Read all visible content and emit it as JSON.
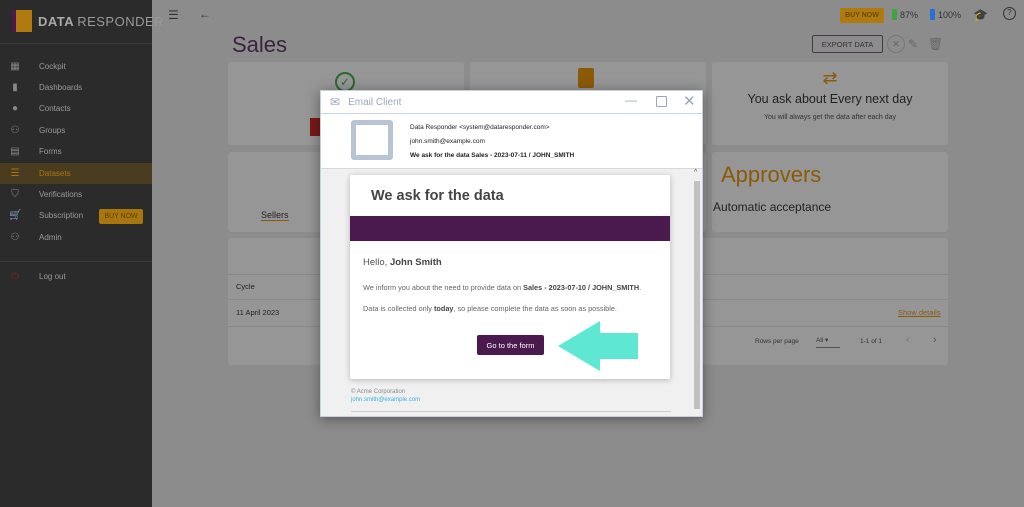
{
  "app": {
    "brand_bold": "DATA",
    "brand_light": "RESPONDER"
  },
  "sidebar": {
    "items": [
      {
        "label": "Cockpit",
        "icon": "▦"
      },
      {
        "label": "Dashboards",
        "icon": "▮"
      },
      {
        "label": "Contacts",
        "icon": "●"
      },
      {
        "label": "Groups",
        "icon": "⚇"
      },
      {
        "label": "Forms",
        "icon": "▤"
      },
      {
        "label": "Datasets",
        "icon": "☰"
      },
      {
        "label": "Verifications",
        "icon": "⛉"
      },
      {
        "label": "Subscription",
        "icon": "🛒"
      },
      {
        "label": "Admin",
        "icon": "⚇"
      }
    ],
    "buy_now": "BUY NOW",
    "logout": "Log out",
    "active": "Datasets"
  },
  "topbar": {
    "buy_now": "BUY NOW",
    "battery1": "87%",
    "battery2": "100%",
    "colors": {
      "battery1": "#3fa63f",
      "battery2": "#2a6fd6"
    }
  },
  "page": {
    "title": "Sales",
    "export": "EXPORT DATA"
  },
  "cards": {
    "frequency_title": "You ask about Every next day",
    "frequency_sub": "You will always get the data after each day",
    "sellers": "Sellers",
    "approvers_title": "Approvers",
    "approvers_sub": "Automatic acceptance"
  },
  "table": {
    "header": "Cycle",
    "rows": [
      {
        "cycle": "11 April 2023",
        "action": "Show details"
      }
    ],
    "rows_per_page_label": "Rows per page",
    "rows_per_page": "All",
    "range": "1-1 of 1"
  },
  "email": {
    "window_title": "Email Client",
    "from": "Data Responder <system@dataresponder.com>",
    "to": "john.smith@example.com",
    "subject": "We ask for the data Sales - 2023-07-11 / JOHN_SMITH",
    "heading": "We ask for the data",
    "hello": "Hello, ",
    "name": "John Smith",
    "p1": "We inform you about the need to provide data on ",
    "p1_bold": "Sales - 2023-07-10 / JOHN_SMITH",
    "p1_end": ".",
    "p2a": "Data is collected only ",
    "p2_bold": "today",
    "p2b": ", so please complete the data as soon as possible.",
    "button": "Go to the form",
    "footer_company": "© Acme Corporation",
    "footer_email": "john.smith@example.com",
    "colors": {
      "brand": "#4a1a4f",
      "arrow": "#5ee8d4"
    }
  }
}
